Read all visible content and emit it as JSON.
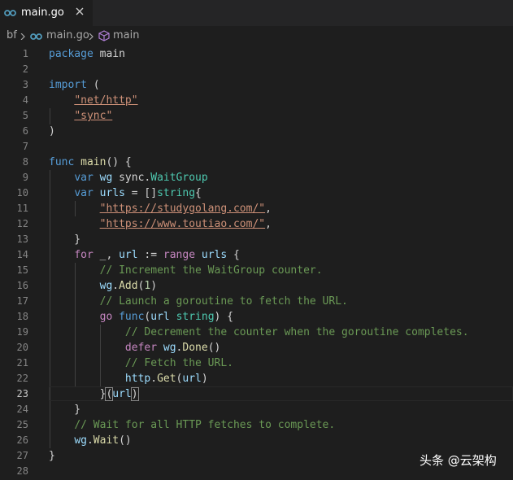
{
  "tab": {
    "label": "main.go",
    "icon": "go-file-icon"
  },
  "breadcrumb": {
    "folder": "bf",
    "file": "main.go",
    "symbol": "main"
  },
  "watermark": "头条 @云架构",
  "colors": {
    "background": "#1e1e1e",
    "keyword": "#569cd6",
    "string": "#ce9178",
    "comment": "#6a9955",
    "function": "#dcdcaa",
    "type": "#4ec9b0"
  },
  "current_line": 23,
  "lines": [
    {
      "n": "1",
      "tokens": [
        [
          "package",
          "k"
        ],
        [
          " main",
          "p"
        ]
      ]
    },
    {
      "n": "2",
      "tokens": []
    },
    {
      "n": "3",
      "tokens": [
        [
          "import",
          "k"
        ],
        [
          " (",
          "p"
        ]
      ]
    },
    {
      "n": "4",
      "tokens": [
        [
          "    ",
          "p"
        ],
        [
          "\"net/http\"",
          "su"
        ]
      ]
    },
    {
      "n": "5",
      "tokens": [
        [
          "    ",
          "p"
        ],
        [
          "\"sync\"",
          "su"
        ]
      ]
    },
    {
      "n": "6",
      "tokens": [
        [
          ")",
          "p"
        ]
      ]
    },
    {
      "n": "7",
      "tokens": []
    },
    {
      "n": "8",
      "tokens": [
        [
          "func",
          "k"
        ],
        [
          " ",
          "p"
        ],
        [
          "main",
          "f"
        ],
        [
          "() {",
          "p"
        ]
      ]
    },
    {
      "n": "9",
      "tokens": [
        [
          "    ",
          "p"
        ],
        [
          "var",
          "k"
        ],
        [
          " ",
          "p"
        ],
        [
          "wg",
          "v"
        ],
        [
          " sync.",
          "p"
        ],
        [
          "WaitGroup",
          "t"
        ]
      ]
    },
    {
      "n": "10",
      "tokens": [
        [
          "    ",
          "p"
        ],
        [
          "var",
          "k"
        ],
        [
          " ",
          "p"
        ],
        [
          "urls",
          "v"
        ],
        [
          " = []",
          "p"
        ],
        [
          "string",
          "t"
        ],
        [
          "{",
          "p"
        ]
      ]
    },
    {
      "n": "11",
      "tokens": [
        [
          "        ",
          "p"
        ],
        [
          "\"https://studygolang.com/\"",
          "su"
        ],
        [
          ",",
          "p"
        ]
      ]
    },
    {
      "n": "12",
      "tokens": [
        [
          "        ",
          "p"
        ],
        [
          "\"https://www.toutiao.com/\"",
          "su"
        ],
        [
          ",",
          "p"
        ]
      ]
    },
    {
      "n": "13",
      "tokens": [
        [
          "    }",
          "p"
        ]
      ]
    },
    {
      "n": "14",
      "tokens": [
        [
          "    ",
          "p"
        ],
        [
          "for",
          "c"
        ],
        [
          " _, ",
          "p"
        ],
        [
          "url",
          "v"
        ],
        [
          " := ",
          "p"
        ],
        [
          "range",
          "c"
        ],
        [
          " ",
          "p"
        ],
        [
          "urls",
          "v"
        ],
        [
          " {",
          "p"
        ]
      ]
    },
    {
      "n": "15",
      "tokens": [
        [
          "        ",
          "p"
        ],
        [
          "// Increment the WaitGroup counter.",
          "m"
        ]
      ]
    },
    {
      "n": "16",
      "tokens": [
        [
          "        ",
          "p"
        ],
        [
          "wg",
          "v"
        ],
        [
          ".",
          "p"
        ],
        [
          "Add",
          "f"
        ],
        [
          "(",
          "p"
        ],
        [
          "1",
          "n"
        ],
        [
          ")",
          "p"
        ]
      ]
    },
    {
      "n": "17",
      "tokens": [
        [
          "        ",
          "p"
        ],
        [
          "// Launch a goroutine to fetch the URL.",
          "m"
        ]
      ]
    },
    {
      "n": "18",
      "tokens": [
        [
          "        ",
          "p"
        ],
        [
          "go",
          "c"
        ],
        [
          " ",
          "p"
        ],
        [
          "func",
          "k"
        ],
        [
          "(",
          "p"
        ],
        [
          "url",
          "v"
        ],
        [
          " ",
          "p"
        ],
        [
          "string",
          "t"
        ],
        [
          ") {",
          "p"
        ]
      ]
    },
    {
      "n": "19",
      "tokens": [
        [
          "            ",
          "p"
        ],
        [
          "// Decrement the counter when the goroutine completes.",
          "m"
        ]
      ]
    },
    {
      "n": "20",
      "tokens": [
        [
          "            ",
          "p"
        ],
        [
          "defer",
          "c"
        ],
        [
          " ",
          "p"
        ],
        [
          "wg",
          "v"
        ],
        [
          ".",
          "p"
        ],
        [
          "Done",
          "f"
        ],
        [
          "()",
          "p"
        ]
      ]
    },
    {
      "n": "21",
      "tokens": [
        [
          "            ",
          "p"
        ],
        [
          "// Fetch the URL.",
          "m"
        ]
      ]
    },
    {
      "n": "22",
      "tokens": [
        [
          "            ",
          "p"
        ],
        [
          "http",
          "v"
        ],
        [
          ".",
          "p"
        ],
        [
          "Get",
          "f"
        ],
        [
          "(",
          "p"
        ],
        [
          "url",
          "v"
        ],
        [
          ")",
          "p"
        ]
      ]
    },
    {
      "n": "23",
      "tokens": [
        [
          "        ",
          "p"
        ],
        [
          "}",
          "pb"
        ],
        [
          "(",
          "pb"
        ],
        [
          "url",
          "v"
        ],
        [
          ")",
          "pb"
        ]
      ]
    },
    {
      "n": "24",
      "tokens": [
        [
          "    }",
          "p"
        ]
      ]
    },
    {
      "n": "25",
      "tokens": [
        [
          "    ",
          "p"
        ],
        [
          "// Wait for all HTTP fetches to complete.",
          "m"
        ]
      ]
    },
    {
      "n": "26",
      "tokens": [
        [
          "    ",
          "p"
        ],
        [
          "wg",
          "v"
        ],
        [
          ".",
          "p"
        ],
        [
          "Wait",
          "f"
        ],
        [
          "()",
          "p"
        ]
      ]
    },
    {
      "n": "27",
      "tokens": [
        [
          "}",
          "p"
        ]
      ]
    },
    {
      "n": "28",
      "tokens": []
    }
  ]
}
